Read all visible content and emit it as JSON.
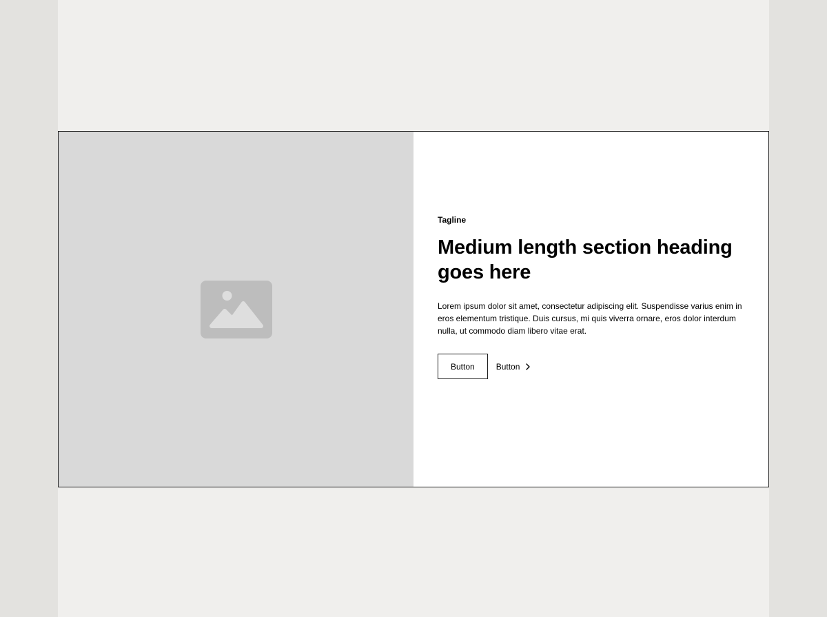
{
  "section": {
    "tagline": "Tagline",
    "heading": "Medium length section heading goes here",
    "body": "Lorem ipsum dolor sit amet, consectetur adipiscing elit. Suspendisse varius enim in eros elementum tristique. Duis cursus, mi quis viverra ornare, eros dolor interdum nulla, ut commodo diam libero vitae erat.",
    "primary_button_label": "Button",
    "secondary_button_label": "Button",
    "secondary_button_icon": "chevron-right-icon",
    "media_icon": "image-placeholder-icon"
  },
  "colors": {
    "outer_background": "#e3e2df",
    "page_background": "#f0efed",
    "media_background": "#d9d9d9",
    "media_icon": "#bdbdbd",
    "content_background": "#ffffff",
    "border": "#1f1f1f"
  }
}
